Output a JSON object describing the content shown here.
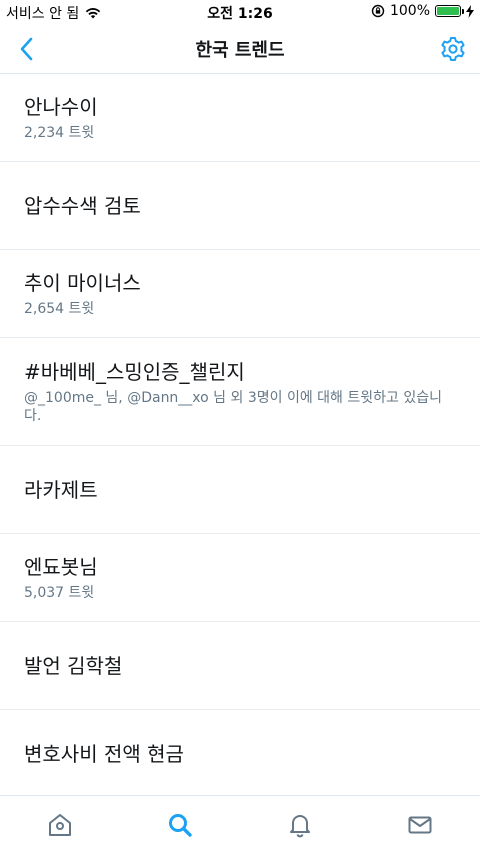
{
  "status_bar": {
    "carrier": "서비스 안 됨",
    "time": "오전 1:26",
    "battery": "100%",
    "battery_level": 1.0,
    "icons": [
      "wifi-icon",
      "rotation-lock-icon",
      "charging-bolt-icon"
    ]
  },
  "header": {
    "title": "한국 트렌드",
    "back_icon": "chevron-left-icon",
    "settings_icon": "gear-icon"
  },
  "trends": [
    {
      "title": "안나수이",
      "subtitle": "2,234 트윗"
    },
    {
      "title": "압수수색 검토",
      "subtitle": ""
    },
    {
      "title": "추이 마이너스",
      "subtitle": "2,654 트윗"
    },
    {
      "title": "#바베베_스밍인증_챌린지",
      "subtitle": "@_100me_ 님, @Dann__xo 님 외 3명이 이에 대해 트윗하고 있습니다."
    },
    {
      "title": "라카제트",
      "subtitle": ""
    },
    {
      "title": "엔됴봇님",
      "subtitle": "5,037 트윗"
    },
    {
      "title": "발언 김학철",
      "subtitle": ""
    },
    {
      "title": "변호사비 전액 현금",
      "subtitle": ""
    }
  ],
  "tab_bar": {
    "tabs": [
      {
        "name": "home",
        "icon": "home-icon",
        "active": false
      },
      {
        "name": "search",
        "icon": "search-icon",
        "active": true
      },
      {
        "name": "notifications",
        "icon": "bell-icon",
        "active": false
      },
      {
        "name": "messages",
        "icon": "envelope-icon",
        "active": false
      }
    ]
  },
  "colors": {
    "accent": "#1da1f2",
    "icon_gray": "#657786",
    "text": "#14171a",
    "divider": "#e6ecf0"
  }
}
